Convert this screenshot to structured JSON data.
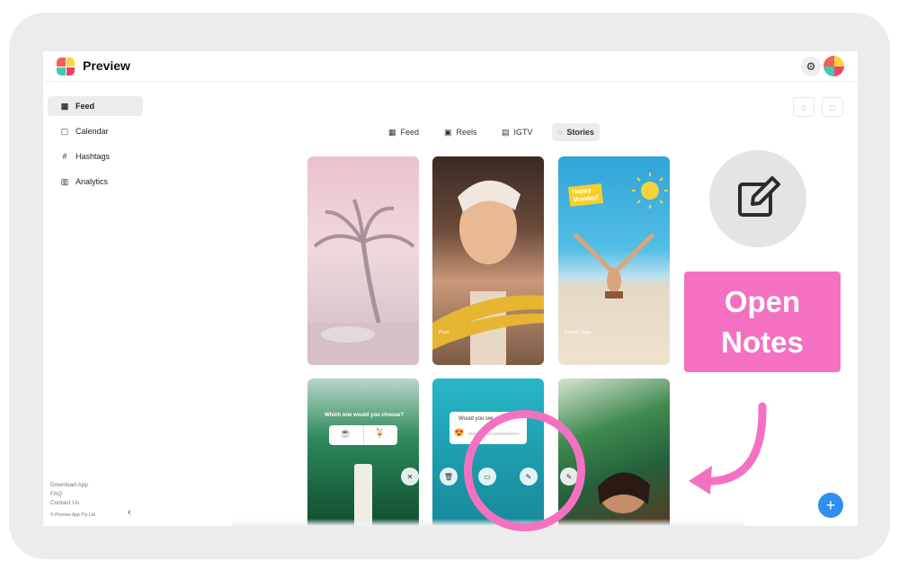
{
  "app": {
    "title": "Preview"
  },
  "sidebar": {
    "items": [
      {
        "label": "Feed",
        "icon": "grid-icon"
      },
      {
        "label": "Calendar",
        "icon": "calendar-icon"
      },
      {
        "label": "Hashtags",
        "icon": "hashtag-icon"
      },
      {
        "label": "Analytics",
        "icon": "bar-chart-icon"
      }
    ],
    "footer_links": [
      "Download App",
      "FAQ",
      "Contact Us"
    ],
    "copyright": "© Preview App Pty Ltd"
  },
  "tabs": [
    {
      "label": "Feed",
      "icon": "grid-icon"
    },
    {
      "label": "Reels",
      "icon": "reels-icon"
    },
    {
      "label": "IGTV",
      "icon": "tv-icon"
    },
    {
      "label": "Stories",
      "icon": "stories-icon",
      "active": true
    }
  ],
  "tiles": {
    "pool_caption": "Pool",
    "beach_caption": "Beach Yoga",
    "sticker_line1": "Happy",
    "sticker_line2": "Monday!",
    "poll_question": "Which one would you choose?",
    "poll_emoji_a": "☕",
    "poll_emoji_b": "🍹",
    "slider_question": "Would you swi",
    "slider_emoji": "😍"
  },
  "callout": {
    "line1": "Open",
    "line2": "Notes"
  },
  "colors": {
    "accent": "#f471c2",
    "fab": "#2d8ff0",
    "active_bg": "#ececec"
  }
}
